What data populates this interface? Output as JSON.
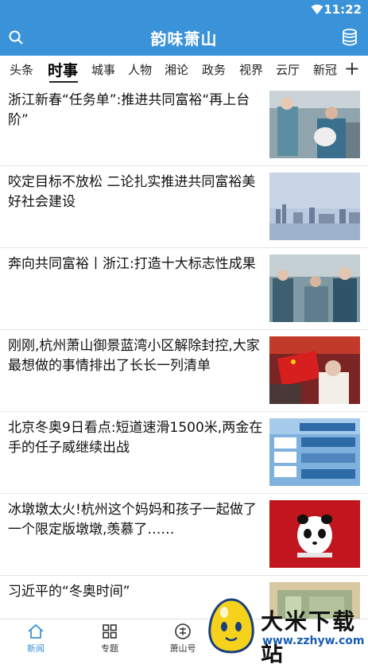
{
  "status_bar": {
    "time": "11:22"
  },
  "header": {
    "title": "韵味萧山"
  },
  "tabs": [
    "头条",
    "时事",
    "城事",
    "人物",
    "湘论",
    "政务",
    "视界",
    "云厅",
    "新冠"
  ],
  "tabs_active": "时事",
  "news": [
    {
      "title": "浙江新春“任务单”:推进共同富裕“再上台阶”"
    },
    {
      "title": "咬定目标不放松 二论扎实推进共同富裕美好社会建设"
    },
    {
      "title": "奔向共同富裕丨浙江:打造十大标志性成果"
    },
    {
      "title": "刚刚,杭州萧山御景蓝湾小区解除封控,大家最想做的事情排出了长长一列清单"
    },
    {
      "title": "北京冬奥9日看点:短道速滑1500米,两金在手的任子威继续出战"
    },
    {
      "title": "冰墩墩太火!杭州这个妈妈和孩子一起做了一个限定版墩墩,羡慕了……"
    },
    {
      "title": "习近平的“冬奥时间”"
    }
  ],
  "bottom_nav": [
    {
      "label": "新闻",
      "icon": "home-icon"
    },
    {
      "label": "专题",
      "icon": "grid-icon"
    },
    {
      "label": "萧山号",
      "icon": "badge-icon"
    }
  ],
  "watermark": {
    "name": "大米下载站",
    "url": "www.zzhyw.com"
  },
  "colors": {
    "brand": "#3a92d8"
  }
}
